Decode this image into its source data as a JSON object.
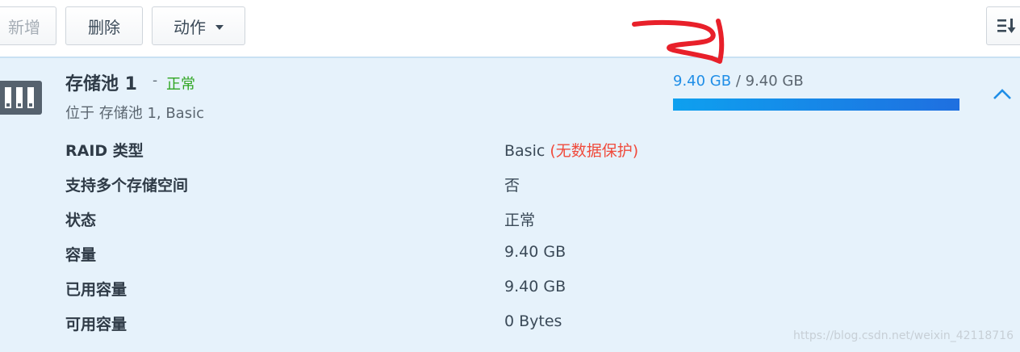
{
  "toolbar": {
    "add_label": "新增",
    "delete_label": "删除",
    "action_label": "动作",
    "sort_icon": "sort-icon"
  },
  "pool": {
    "name": "存储池 1",
    "separator": "-",
    "status": "正常",
    "subtitle": "位于 存储池 1, Basic",
    "used": "9.40 GB",
    "usage_separator": " / ",
    "total": "9.40 GB",
    "usage_fraction": 1.0,
    "icon": "storage-pool-icon",
    "collapse_icon": "chevron-up-icon"
  },
  "details": {
    "raid_type_label": "RAID 类型",
    "raid_type_value": "Basic",
    "raid_type_note": "(无数据保护)",
    "multi_volume_label": "支持多个存储空间",
    "multi_volume_value": "否",
    "status_label": "状态",
    "status_value": "正常",
    "capacity_label": "容量",
    "capacity_value": "9.40 GB",
    "used_capacity_label": "已用容量",
    "used_capacity_value": "9.40 GB",
    "available_capacity_label": "可用容量",
    "available_capacity_value": "0 Bytes"
  },
  "watermark": "https://blog.csdn.net/weixin_42118716",
  "colors": {
    "accent": "#1f8ee7",
    "ok": "#2ea521",
    "warning": "#f04b3c",
    "panel_bg": "#e6f2fb",
    "annotation_red": "#e8202a"
  }
}
